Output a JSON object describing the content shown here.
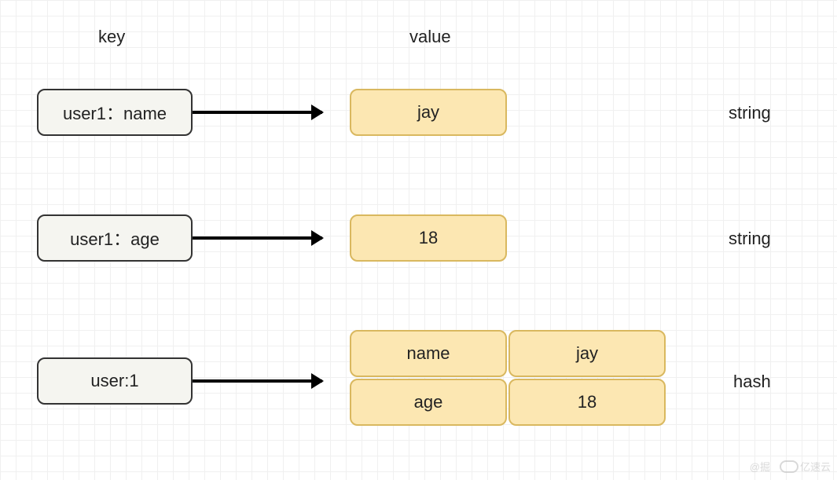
{
  "headers": {
    "key": "key",
    "value": "value"
  },
  "rows": {
    "row1": {
      "key": "user1：name",
      "value": "jay",
      "type": "string"
    },
    "row2": {
      "key": "user1：age",
      "value": "18",
      "type": "string"
    },
    "row3": {
      "key": "user:1",
      "hash": {
        "field1": "name",
        "value1": "jay",
        "field2": "age",
        "value2": "18"
      },
      "type": "hash"
    }
  },
  "watermark": {
    "author": "@掘",
    "brand": "亿速云"
  }
}
